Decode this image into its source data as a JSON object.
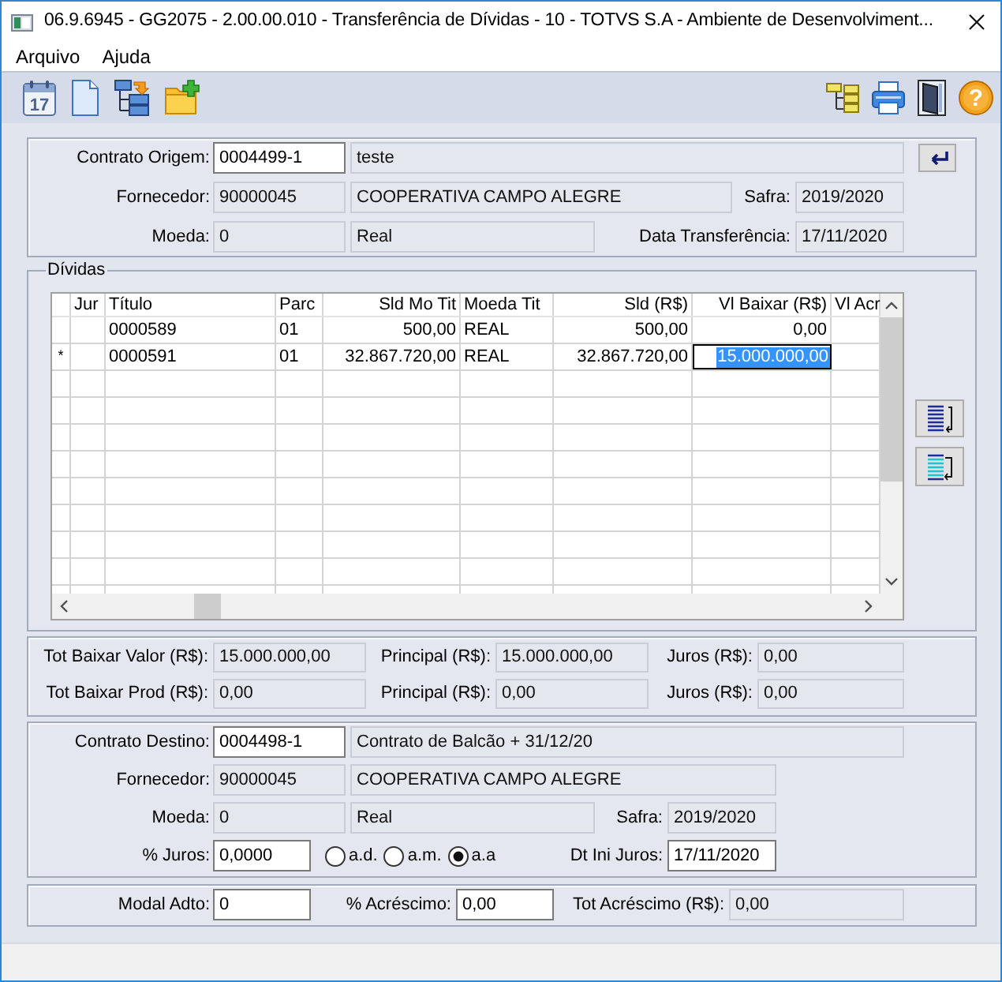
{
  "window": {
    "title": "06.9.6945 - GG2075 - 2.00.00.010 - Transferência de Dívidas - 10 - TOTVS S.A - Ambiente de Desenvolviment..."
  },
  "menu": [
    {
      "label": "Arquivo"
    },
    {
      "label": "Ajuda"
    }
  ],
  "toolbar": {
    "left": [
      {
        "kind": "calendar",
        "text": "17"
      },
      {
        "kind": "document"
      },
      {
        "kind": "hierarchy"
      },
      {
        "kind": "folder_add"
      }
    ],
    "right": [
      {
        "kind": "tree"
      },
      {
        "kind": "printer"
      },
      {
        "kind": "exit"
      },
      {
        "kind": "help",
        "text": "?"
      }
    ]
  },
  "origin": {
    "contract": {
      "label": "Contrato Origem:",
      "code": {
        "value": "0004499-1",
        "readonly": false
      },
      "description": {
        "value": "teste",
        "readonly": true
      }
    },
    "supplier": {
      "label": "Fornecedor:",
      "code": {
        "value": "90000045",
        "readonly": true
      },
      "name": {
        "value": "COOPERATIVA CAMPO ALEGRE",
        "readonly": true
      }
    },
    "harvest": {
      "label": "Safra:",
      "value": "2019/2020",
      "readonly": true
    },
    "currency": {
      "label": "Moeda:",
      "code": {
        "value": "0",
        "readonly": true
      },
      "name": {
        "value": "Real",
        "readonly": true
      }
    },
    "transfer_date": {
      "label": "Data Transferência:",
      "value": "17/11/2020",
      "readonly": true
    }
  },
  "debts": {
    "title": "Dívidas",
    "columns": [
      "Jur",
      "Título",
      "Parc",
      "Sld Mo Tit",
      "Moeda Tit",
      "Sld (R$)",
      "Vl Baixar (R$)",
      "Vl Acr"
    ],
    "rows": [
      {
        "selected": false,
        "titulo": "0000589",
        "parc": "01",
        "sld_mo_tit": "500,00",
        "moeda_tit": "REAL",
        "sld": "500,00",
        "vl_baixar": "0,00"
      },
      {
        "selected": true,
        "marker": "*",
        "titulo": "0000591",
        "parc": "01",
        "sld_mo_tit": "32.867.720,00",
        "moeda_tit": "REAL",
        "sld": "32.867.720,00",
        "vl_baixar": "15.000.000,00"
      }
    ]
  },
  "totals": [
    {
      "total": {
        "label": "Tot Baixar Valor (R$):",
        "value": "15.000.000,00",
        "readonly": true
      },
      "principal": {
        "label": "Principal (R$):",
        "value": "15.000.000,00",
        "readonly": true
      },
      "interest": {
        "label": "Juros (R$):",
        "value": "0,00",
        "readonly": true
      }
    },
    {
      "total": {
        "label": "Tot Baixar Prod (R$):",
        "value": "0,00",
        "readonly": true
      },
      "principal": {
        "label": "Principal (R$):",
        "value": "0,00",
        "readonly": true
      },
      "interest": {
        "label": "Juros (R$):",
        "value": "0,00",
        "readonly": true
      }
    }
  ],
  "destination": {
    "contract": {
      "label": "Contrato Destino:",
      "code": {
        "value": "0004498-1",
        "readonly": false
      },
      "description": {
        "value": "Contrato de Balcão + 31/12/20",
        "readonly": true
      }
    },
    "supplier": {
      "label": "Fornecedor:",
      "code": {
        "value": "90000045",
        "readonly": true
      },
      "name": {
        "value": "COOPERATIVA CAMPO ALEGRE",
        "readonly": true
      }
    },
    "currency": {
      "label": "Moeda:",
      "code": {
        "value": "0",
        "readonly": true
      },
      "name": {
        "value": "Real",
        "readonly": true
      }
    },
    "harvest": {
      "label": "Safra:",
      "value": "2019/2020",
      "readonly": true
    },
    "interest_rate": {
      "label": "% Juros:",
      "value": "0,0000",
      "readonly": false
    },
    "periods": [
      {
        "label": "a.d.",
        "selected": false
      },
      {
        "label": "a.m.",
        "selected": false
      },
      {
        "label": "a.a",
        "selected": true
      }
    ],
    "interest_start": {
      "label": "Dt Ini Juros:",
      "value": "17/11/2020",
      "readonly": false
    }
  },
  "surcharge": {
    "modal": {
      "label": "Modal Adto:",
      "value": "0",
      "readonly": false
    },
    "rate": {
      "label": "% Acréscimo:",
      "value": "0,00",
      "readonly": false
    },
    "total": {
      "label": "Tot Acréscimo (R$):",
      "value": "0,00",
      "readonly": true
    }
  }
}
